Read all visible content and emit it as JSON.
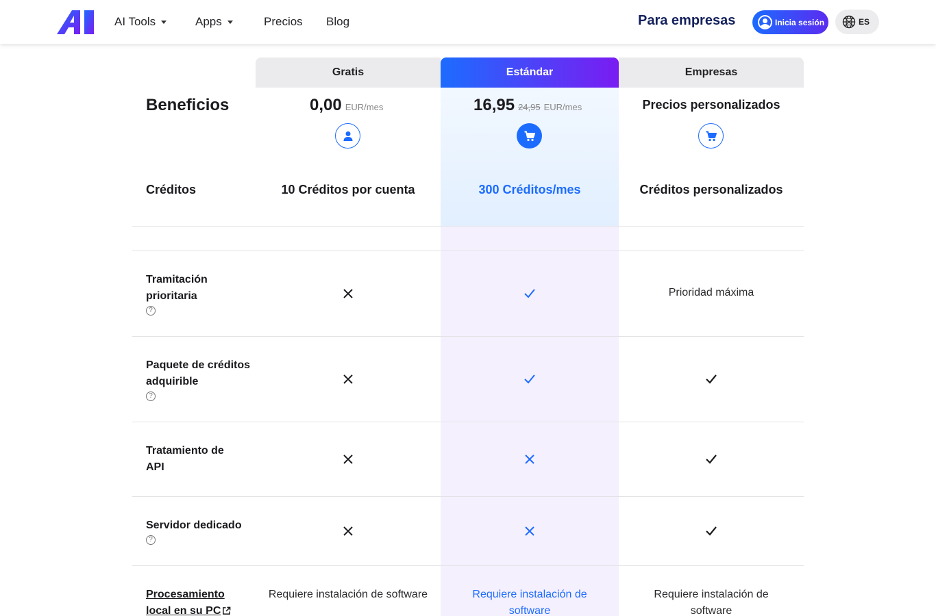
{
  "header": {
    "nav": [
      {
        "label": "AI Tools",
        "dropdown": true
      },
      {
        "label": "Apps",
        "dropdown": true
      },
      {
        "label": "Precios",
        "dropdown": false
      },
      {
        "label": "Blog",
        "dropdown": false
      }
    ],
    "enterprise_label": "Para empresas",
    "login_label": "Inicia sesión",
    "language": "ES"
  },
  "plans": {
    "gratis": {
      "name": "Gratis",
      "price": "0,00",
      "unit": "EUR/mes",
      "icon": "user-icon",
      "credits": "10 Créditos por cuenta"
    },
    "estandar": {
      "name": "Estándar",
      "price": "16,95",
      "old_price": "24,95",
      "unit": "EUR/mes",
      "icon": "cart-icon",
      "credits": "300 Créditos/mes"
    },
    "empresas": {
      "name": "Empresas",
      "price": "Precios personalizados",
      "icon": "cart-icon",
      "credits": "Créditos personalizados"
    }
  },
  "table": {
    "benefits_title": "Beneficios",
    "credits_label": "Créditos",
    "rows": [
      {
        "label": "Tramitación prioritaria",
        "help": true,
        "gratis": "cross",
        "estandar": "check",
        "empresas": "Prioridad máxima"
      },
      {
        "label": "Paquete de créditos adquirible",
        "help": true,
        "gratis": "cross",
        "estandar": "check",
        "empresas": "check"
      },
      {
        "label": "Tratamiento de API",
        "help": false,
        "gratis": "cross",
        "estandar": "cross",
        "empresas": "check"
      },
      {
        "label": "Servidor dedicado",
        "help": true,
        "gratis": "cross",
        "estandar": "cross",
        "empresas": "check"
      },
      {
        "label": "Procesamiento local en su PC",
        "help": false,
        "link": true,
        "gratis": "Requiere instalación de software",
        "estandar": "Requiere instalación de software",
        "empresas": "Requiere instalación de software"
      }
    ]
  },
  "colors": {
    "accent": "#1c6cff",
    "brand_gradient_end": "#7a1cf2",
    "dark_navy": "#14215c"
  }
}
